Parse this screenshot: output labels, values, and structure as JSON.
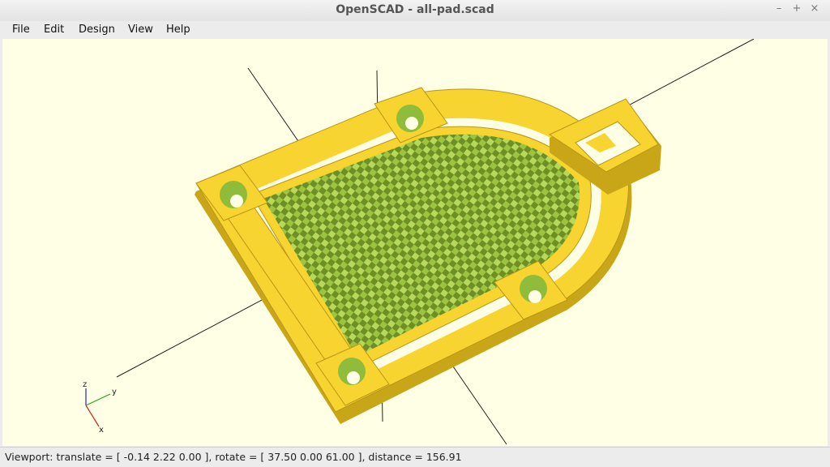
{
  "window": {
    "title": "OpenSCAD - all-pad.scad",
    "controls": [
      "–",
      "+",
      "×"
    ]
  },
  "menubar": [
    {
      "label": "File"
    },
    {
      "label": "Edit"
    },
    {
      "label": "Design"
    },
    {
      "label": "View"
    },
    {
      "label": "Help"
    }
  ],
  "viewport": {
    "background_color": "#ffffe5",
    "model_color_top": "#f7d42f",
    "model_color_side": "#c9a618",
    "model_color_inner": "#8fbc3a",
    "axis_indicator": {
      "z": "z",
      "y": "y",
      "x": "x"
    }
  },
  "status": {
    "text": "Viewport: translate = [ -0.14 2.22 0.00 ], rotate = [ 37.50 0.00 61.00 ], distance = 156.91"
  }
}
